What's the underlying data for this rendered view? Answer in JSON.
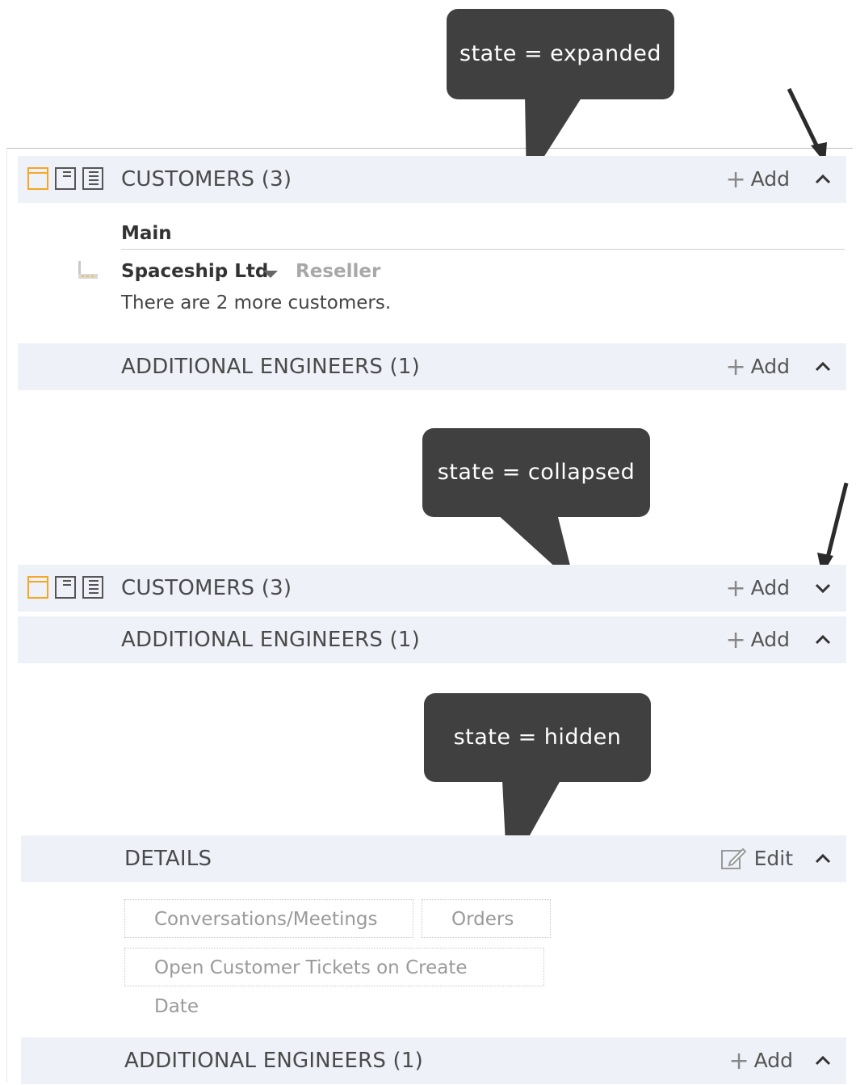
{
  "callouts": {
    "expanded": "state = expanded",
    "collapsed": "state = collapsed",
    "hidden": "state = hidden"
  },
  "section_expanded": {
    "customers": {
      "title": "CUSTOMERS (3)",
      "add_label": "Add",
      "chevron": "chevron-up-icon"
    },
    "subheading": "Main",
    "customer_name": "Spaceship Ltd",
    "customer_role": "Reseller",
    "more_text": "There are 2 more customers.",
    "engineers": {
      "title": "ADDITIONAL ENGINEERS (1)",
      "add_label": "Add",
      "chevron": "chevron-up-icon"
    }
  },
  "section_collapsed": {
    "customers": {
      "title": "CUSTOMERS (3)",
      "add_label": "Add",
      "chevron": "chevron-down-icon"
    },
    "engineers": {
      "title": "ADDITIONAL ENGINEERS (1)",
      "add_label": "Add",
      "chevron": "chevron-up-icon"
    }
  },
  "section_hidden": {
    "details": {
      "title": "DETAILS",
      "edit_label": "Edit",
      "chevron": "chevron-up-icon"
    },
    "tags": [
      "Conversations/Meetings",
      "Orders",
      "Open Customer Tickets on Create Date"
    ],
    "engineers": {
      "title": "ADDITIONAL ENGINEERS (1)",
      "add_label": "Add",
      "chevron": "chevron-up-icon"
    }
  },
  "colors": {
    "bar_background": "#eef1f8",
    "callout": "#404040",
    "layout_icon_active": "#f5a623"
  }
}
